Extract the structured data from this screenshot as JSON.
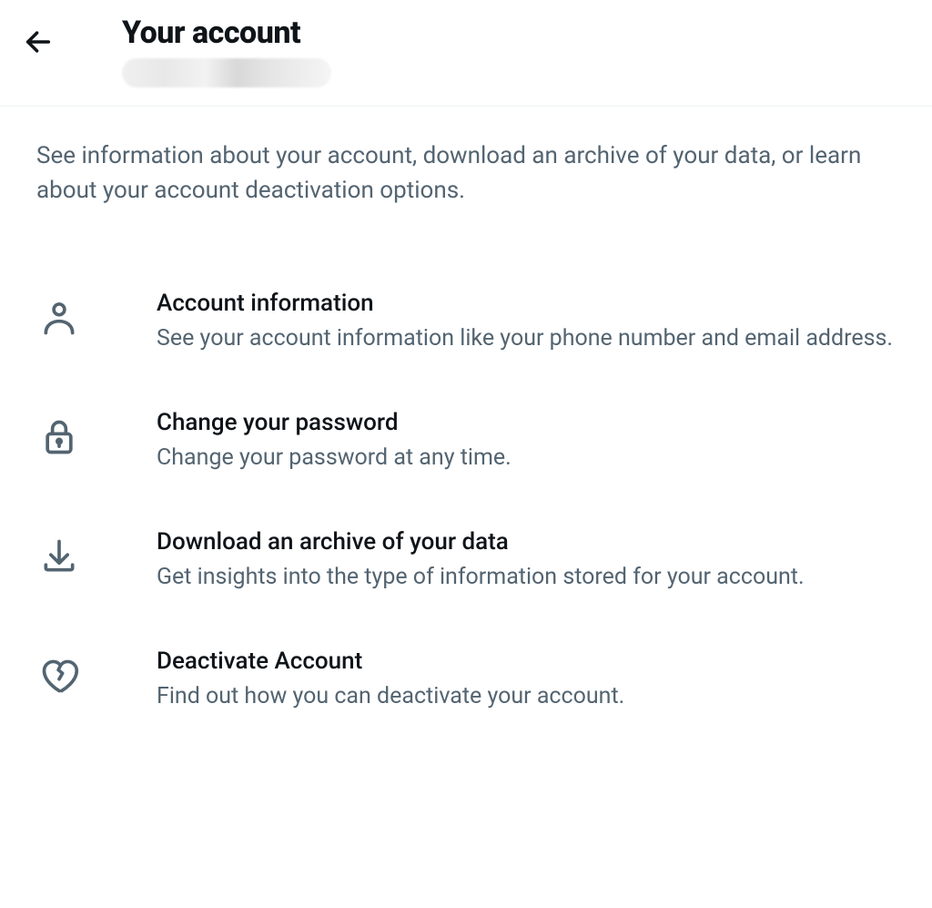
{
  "header": {
    "title": "Your account"
  },
  "description": "See information about your account, download an archive of your data, or learn about your account deactivation options.",
  "options": [
    {
      "title": "Account information",
      "desc": "See your account information like your phone number and email address."
    },
    {
      "title": "Change your password",
      "desc": "Change your password at any time."
    },
    {
      "title": "Download an archive of your data",
      "desc": "Get insights into the type of information stored for your account."
    },
    {
      "title": "Deactivate Account",
      "desc": "Find out how you can deactivate your account."
    }
  ]
}
